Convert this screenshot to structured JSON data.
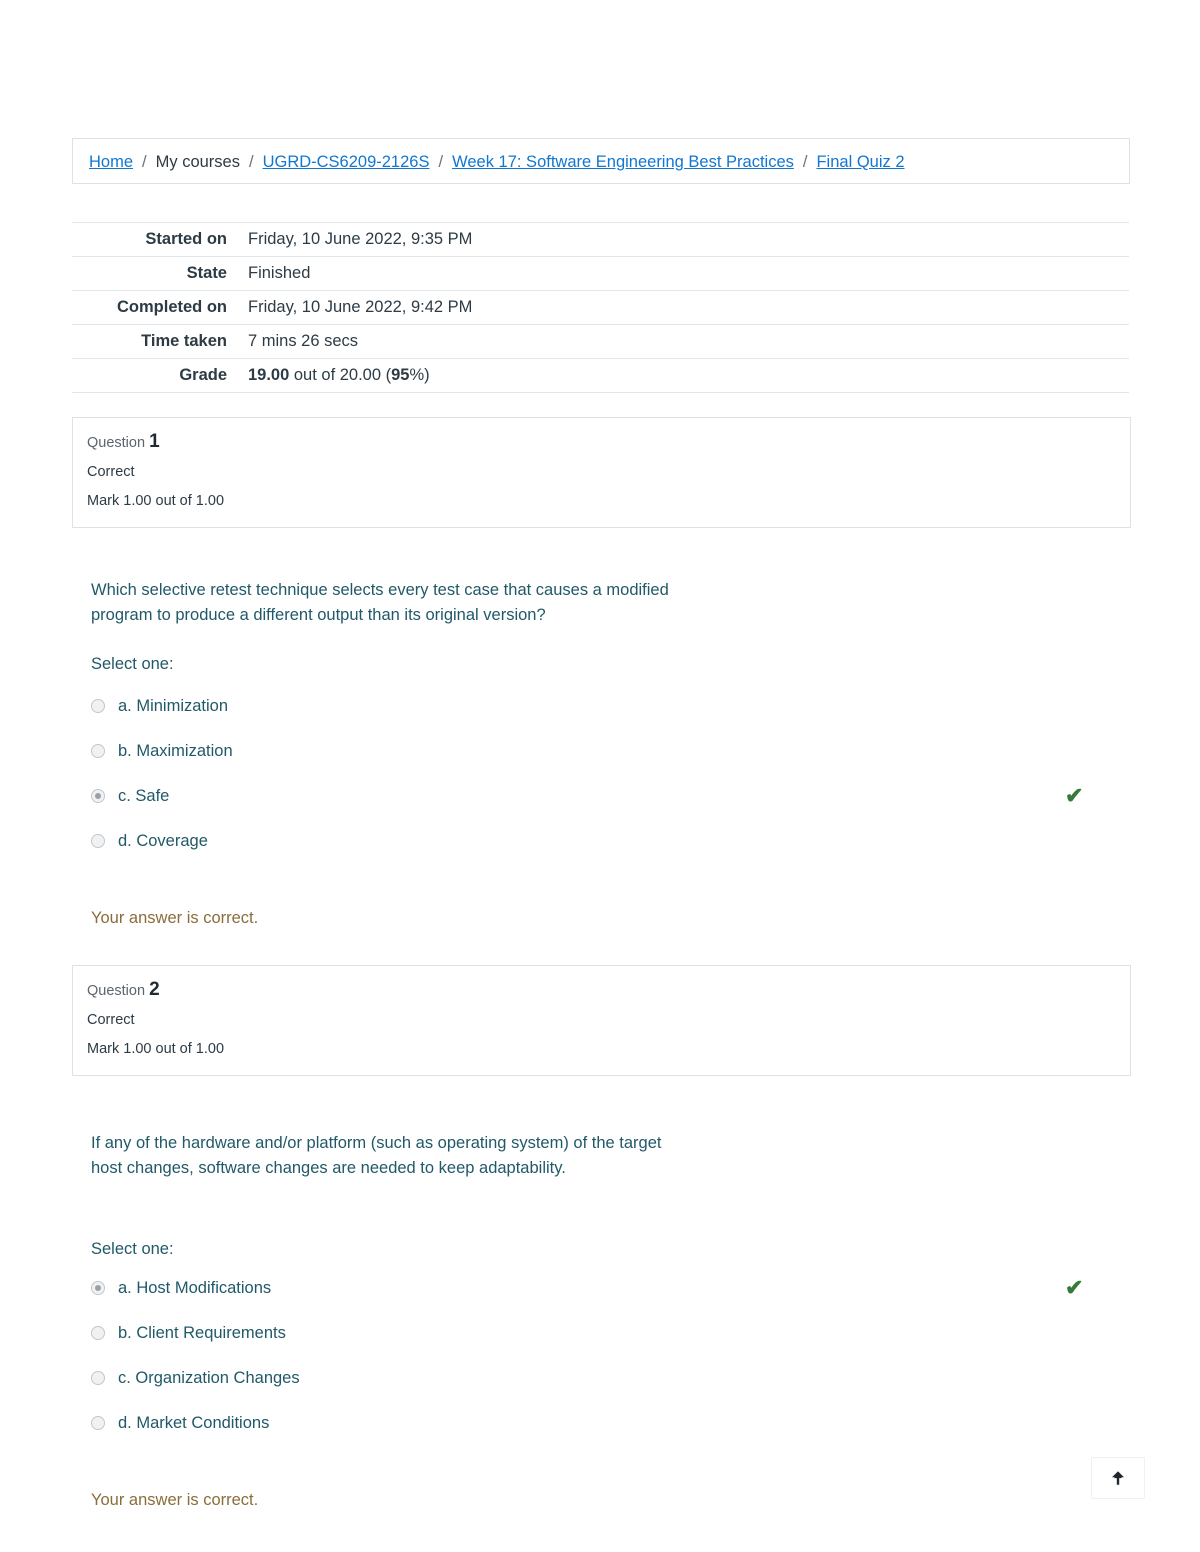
{
  "breadcrumb": {
    "items": [
      {
        "label": "Home",
        "type": "link"
      },
      {
        "label": "My courses",
        "type": "text"
      },
      {
        "label": "UGRD-CS6209-2126S",
        "type": "link"
      },
      {
        "label": "Week 17: Software Engineering Best Practices",
        "type": "link"
      },
      {
        "label": "Final Quiz 2",
        "type": "link"
      }
    ],
    "separator": "/"
  },
  "summary": {
    "rows": [
      {
        "label": "Started on",
        "value": "Friday, 10 June 2022, 9:35 PM"
      },
      {
        "label": "State",
        "value": "Finished"
      },
      {
        "label": "Completed on",
        "value": "Friday, 10 June 2022, 9:42 PM"
      },
      {
        "label": "Time taken",
        "value": "7 mins 26 secs"
      }
    ],
    "grade": {
      "label": "Grade",
      "score": "19.00",
      "middle": " out of 20.00 (",
      "percent": "95",
      "suffix": "%)"
    }
  },
  "questions": [
    {
      "number_label": "Question",
      "number": "1",
      "state": "Correct",
      "mark": "Mark 1.00 out of 1.00",
      "text": "Which selective retest technique selects every test case that causes a modified program to produce a different output than its original version?",
      "select_one": "Select one:",
      "options": [
        {
          "label": "a. Minimization",
          "selected": false,
          "correct": false
        },
        {
          "label": "b. Maximization",
          "selected": false,
          "correct": false
        },
        {
          "label": "c. Safe",
          "selected": true,
          "correct": true
        },
        {
          "label": "d. Coverage",
          "selected": false,
          "correct": false
        }
      ],
      "feedback": "Your answer is correct."
    },
    {
      "number_label": "Question",
      "number": "2",
      "state": "Correct",
      "mark": "Mark 1.00 out of 1.00",
      "text": "If any of the hardware and/or platform (such as operating system) of the target host changes, software changes are needed to keep adaptability.",
      "select_one": "Select one:",
      "options": [
        {
          "label": "a. Host Modifications",
          "selected": true,
          "correct": true
        },
        {
          "label": "b. Client Requirements",
          "selected": false,
          "correct": false
        },
        {
          "label": "c. Organization Changes",
          "selected": false,
          "correct": false
        },
        {
          "label": "d. Market Conditions",
          "selected": false,
          "correct": false
        }
      ],
      "feedback": "Your answer is correct."
    }
  ],
  "scroll_top_button": {
    "icon": "arrow-up-icon"
  },
  "colors": {
    "link": "#1177d1",
    "question_text": "#215968",
    "correct_mark": "#357a38",
    "feedback": "#8a6d3b"
  }
}
